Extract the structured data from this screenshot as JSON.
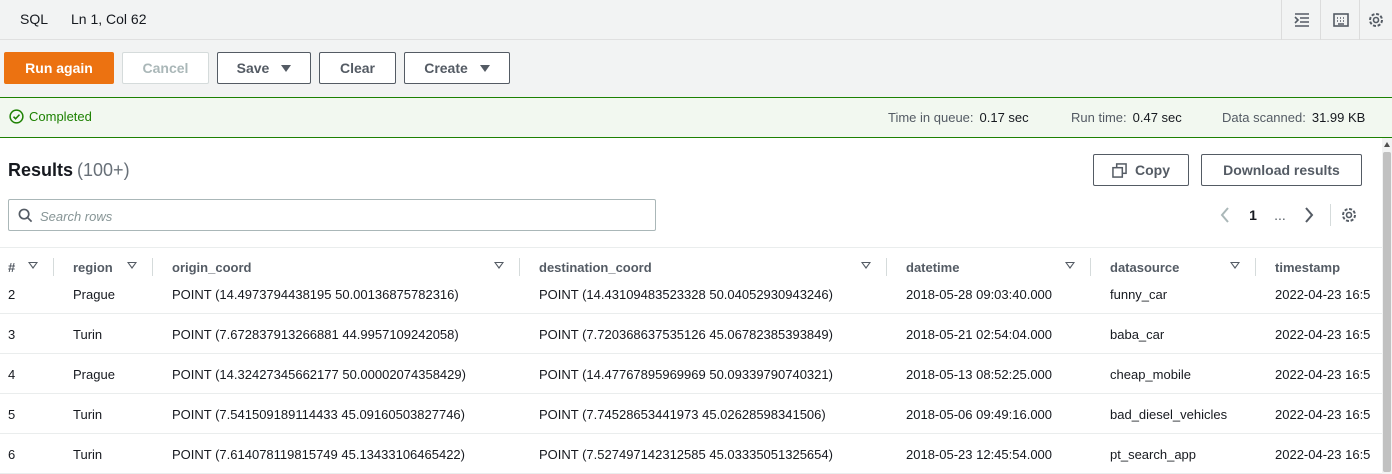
{
  "statusbar": {
    "language": "SQL",
    "cursor": "Ln 1, Col 62",
    "icons": [
      "format-icon",
      "keyboard-icon",
      "settings-icon"
    ]
  },
  "toolbar": {
    "run_label": "Run again",
    "cancel_label": "Cancel",
    "save_label": "Save",
    "clear_label": "Clear",
    "create_label": "Create"
  },
  "status": {
    "state": "Completed",
    "queue_label": "Time in queue:",
    "queue_value": "0.17 sec",
    "run_label": "Run time:",
    "run_value": "0.47 sec",
    "scanned_label": "Data scanned:",
    "scanned_value": "31.99 KB",
    "color": "#1d8102"
  },
  "results": {
    "title": "Results",
    "count": "(100+)",
    "copy_label": "Copy",
    "download_label": "Download results",
    "search_placeholder": "Search rows",
    "page": "1",
    "ellipsis": "..."
  },
  "columns": [
    "#",
    "region",
    "origin_coord",
    "destination_coord",
    "datetime",
    "datasource",
    "timestamp"
  ],
  "rows": [
    [
      "2",
      "Prague",
      "POINT (14.4973794438195 50.00136875782316)",
      "POINT (14.43109483523328 50.04052930943246)",
      "2018-05-28 09:03:40.000",
      "funny_car",
      "2022-04-23 16:5"
    ],
    [
      "3",
      "Turin",
      "POINT (7.672837913266881 44.9957109242058)",
      "POINT (7.720368637535126 45.06782385393849)",
      "2018-05-21 02:54:04.000",
      "baba_car",
      "2022-04-23 16:5"
    ],
    [
      "4",
      "Prague",
      "POINT (14.32427345662177 50.00002074358429)",
      "POINT (14.47767895969969 50.09339790740321)",
      "2018-05-13 08:52:25.000",
      "cheap_mobile",
      "2022-04-23 16:5"
    ],
    [
      "5",
      "Turin",
      "POINT (7.541509189114433 45.09160503827746)",
      "POINT (7.74528653441973 45.02628598341506)",
      "2018-05-06 09:49:16.000",
      "bad_diesel_vehicles",
      "2022-04-23 16:5"
    ],
    [
      "6",
      "Turin",
      "POINT (7.614078119815749 45.13433106465422)",
      "POINT (7.527497142312585 45.03335051325654)",
      "2018-05-23 12:45:54.000",
      "pt_search_app",
      "2022-04-23 16:5"
    ]
  ],
  "colors": {
    "primary": "#ec7211",
    "success": "#1d8102",
    "text": "#16191f"
  }
}
